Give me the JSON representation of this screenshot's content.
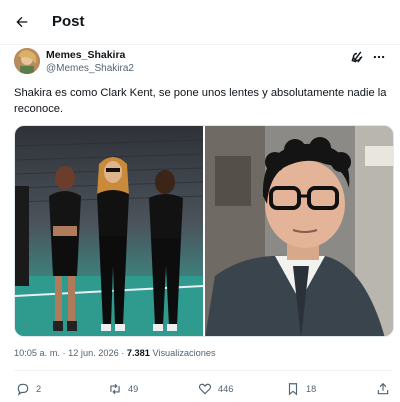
{
  "header": {
    "title": "Post",
    "back_icon": "back-arrow-icon"
  },
  "author": {
    "display_name": "Memes_Shakira",
    "handle": "@Memes_Shakira2"
  },
  "tweet": {
    "text": "Shakira es como Clark Kent, se pone unos lentes y absolutamente nadie la reconoce."
  },
  "meta": {
    "time": "10:05 a. m.",
    "sep1": " · ",
    "date": "12 jun. 2026",
    "sep2": " · ",
    "views_count": "7.381",
    "views_label": " Visualizaciones"
  },
  "actions": {
    "replies": "2",
    "reposts": "49",
    "likes": "446",
    "bookmarks": "18"
  },
  "colors": {
    "text": "#0f1419",
    "secondary": "#536471",
    "divider": "#eff3f4"
  }
}
